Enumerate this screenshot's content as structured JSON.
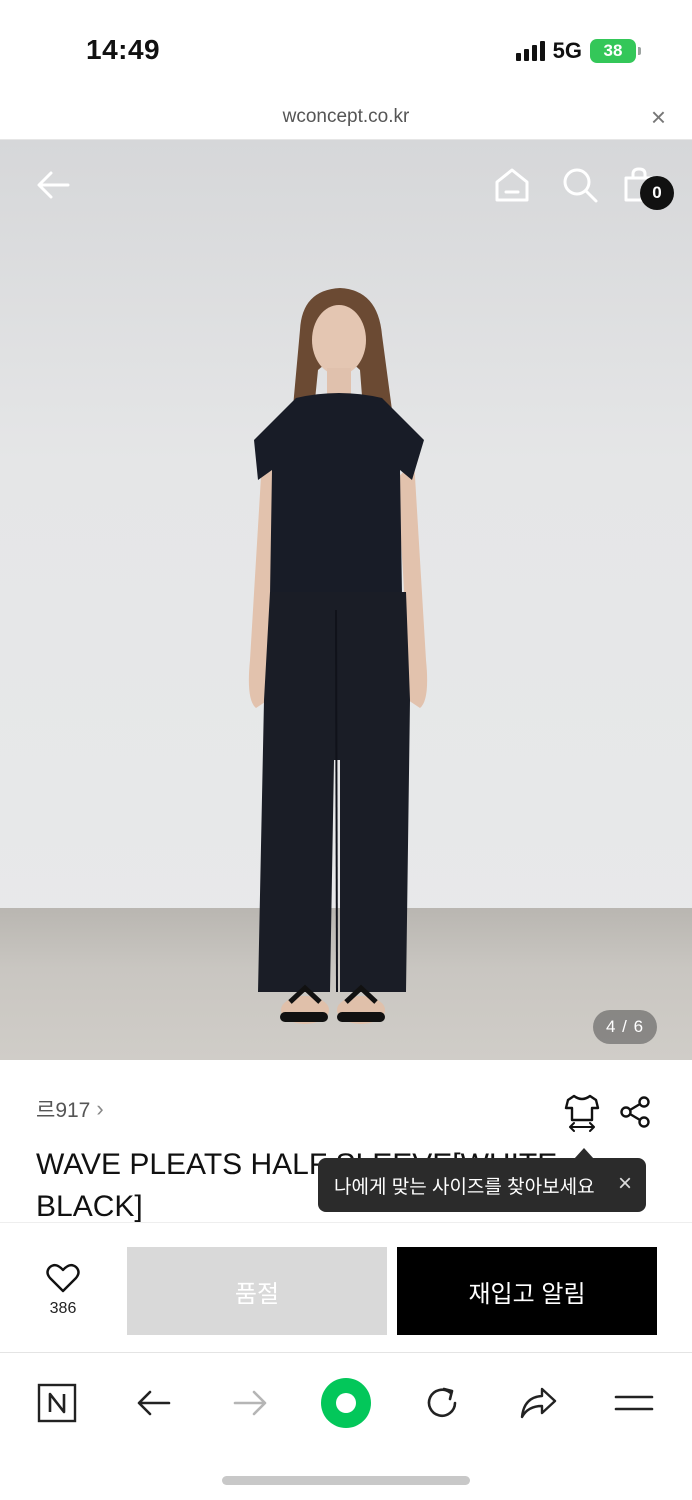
{
  "status_bar": {
    "time": "14:49",
    "network": "5G",
    "battery": "38",
    "battery_color": "#34c759"
  },
  "url_bar": {
    "url": "wconcept.co.kr",
    "close_icon": "close-icon"
  },
  "header": {
    "back_icon": "back-arrow-icon",
    "home_icon": "home-icon",
    "search_icon": "search-icon",
    "cart_icon": "shopping-bag-icon",
    "cart_count": "0"
  },
  "gallery": {
    "counter": "4 / 6"
  },
  "product": {
    "brand": "르917",
    "title": "WAVE PLEATS HALF SLEEVE[WHITE BLACK]",
    "size_icon": "size-guide-icon",
    "share_icon": "share-icon"
  },
  "tooltip": {
    "text": "나에게 맞는 사이즈를 찾아보세요",
    "close_label": "×"
  },
  "action_bar": {
    "like_count": "386",
    "soldout_label": "품절",
    "restock_label": "재입고 알림",
    "soldout_color": "#d9d9d9",
    "restock_color": "#000000"
  },
  "browser_toolbar": {
    "items": [
      "naver-icon",
      "back-icon",
      "forward-icon",
      "green-dot-icon",
      "reload-icon",
      "share-icon",
      "menu-icon"
    ],
    "accent_color": "#03c75a"
  }
}
